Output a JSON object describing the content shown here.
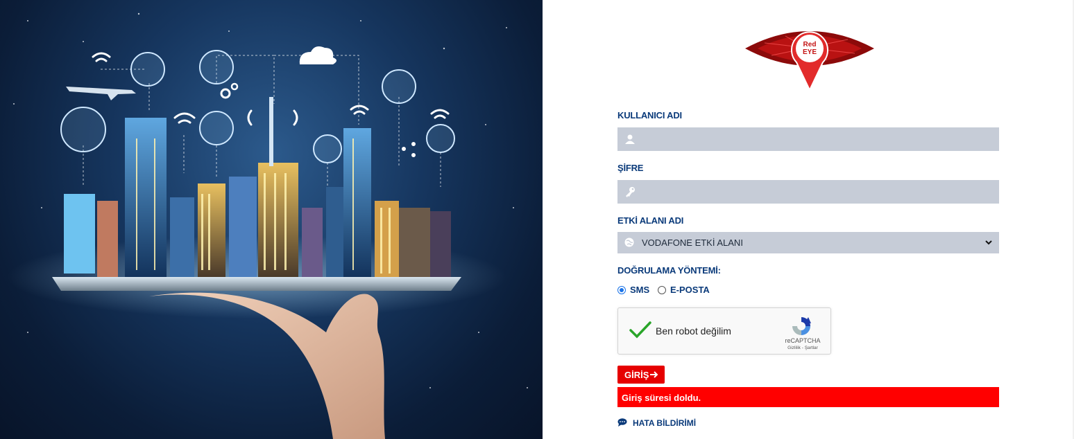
{
  "logo": {
    "line1": "Red",
    "line2": "EYE"
  },
  "form": {
    "username_label": "KULLANICI ADI",
    "username_value": "",
    "password_label": "ŞİFRE",
    "password_value": "",
    "domain_label": "ETKİ ALANI ADI",
    "domain_value": "VODAFONE ETKİ ALANI",
    "verify_label": "DOĞRULAMA YÖNTEMİ:",
    "verify_options": [
      "SMS",
      "E-POSTA"
    ],
    "verify_selected": "SMS",
    "submit_label": "GİRİŞ"
  },
  "captcha": {
    "text": "Ben robot değilim",
    "brand": "reCAPTCHA",
    "links": "Gizlilik - Şartlar",
    "checked": true
  },
  "error": {
    "message": "Giriş süresi doldu."
  },
  "report": {
    "label": "HATA BİLDİRİMİ"
  },
  "colors": {
    "brand_red": "#e60000",
    "label_blue": "#0a3a7a",
    "field_gray": "#c6ccd7"
  }
}
